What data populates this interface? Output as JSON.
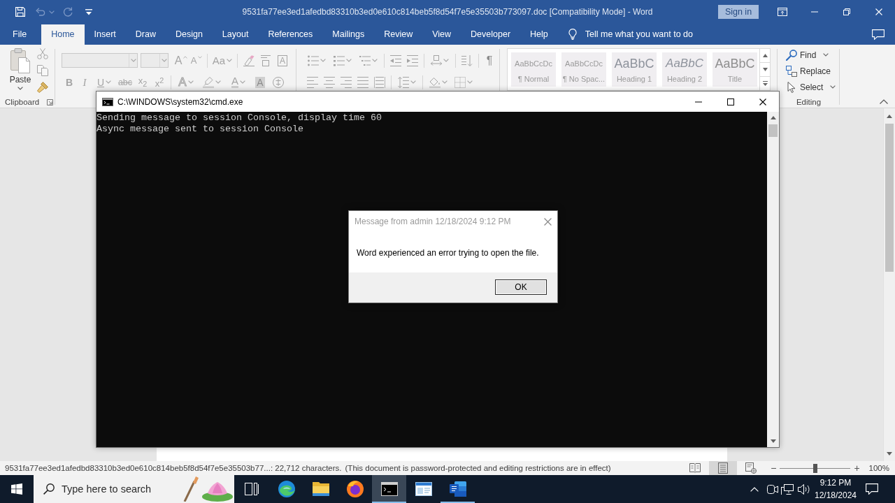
{
  "word_window": {
    "title": "9531fa77ee3ed1afedbd83310b3ed0e610c814beb5f8d54f7e5e35503b773097.doc [Compatibility Mode] - Word",
    "sign_in": "Sign in",
    "tabs": [
      {
        "label": "File",
        "selected": false
      },
      {
        "label": "Home",
        "selected": true
      },
      {
        "label": "Insert",
        "selected": false
      },
      {
        "label": "Draw",
        "selected": false
      },
      {
        "label": "Design",
        "selected": false
      },
      {
        "label": "Layout",
        "selected": false
      },
      {
        "label": "References",
        "selected": false
      },
      {
        "label": "Mailings",
        "selected": false
      },
      {
        "label": "Review",
        "selected": false
      },
      {
        "label": "View",
        "selected": false
      },
      {
        "label": "Developer",
        "selected": false
      },
      {
        "label": "Help",
        "selected": false
      }
    ],
    "tell_me": {
      "placeholder": "Tell me what you want to do"
    },
    "ribbon": {
      "clipboard": {
        "paste": "Paste",
        "label": "Clipboard"
      },
      "font": {
        "row_1": [
          {
            "kind": "grow",
            "label": "A"
          },
          {
            "kind": "shrink",
            "label": "A"
          },
          {
            "kind": "case",
            "label": "Aa"
          },
          {
            "kind": "clear"
          },
          {
            "kind": "phonetic"
          },
          {
            "kind": "border",
            "label": "A"
          }
        ],
        "row_2": [
          {
            "kind": "bold",
            "label": "B"
          },
          {
            "kind": "italic",
            "label": "I"
          },
          {
            "kind": "underline",
            "label": "U"
          },
          {
            "kind": "strike",
            "label": "abc"
          },
          {
            "kind": "subscript",
            "label": "x$_{2}$"
          },
          {
            "kind": "superscript",
            "label": "x$^{2}$"
          },
          {
            "kind": "effects",
            "label": "A"
          },
          {
            "kind": "highlight"
          },
          {
            "kind": "color",
            "label": "A"
          },
          {
            "kind": "shading",
            "label": "A"
          },
          {
            "kind": "enclosed"
          }
        ]
      },
      "paragraph": {
        "show_marks": "¶"
      },
      "styles": [
        {
          "kind": "body",
          "preview": "AaBbCcDc",
          "name": "¶ Normal",
          "selected": false
        },
        {
          "kind": "body",
          "preview": "AaBbCcDc",
          "name": "¶ No Spac...",
          "selected": false
        },
        {
          "kind": "heading",
          "preview": "AaBbC",
          "name": "Heading 1",
          "selected": false
        },
        {
          "kind": "subheading",
          "preview": "AaBbC",
          "name": "Heading 2",
          "selected": false
        },
        {
          "kind": "title",
          "preview": "AaBbC",
          "name": "Title",
          "selected": false
        }
      ],
      "editing": {
        "find": "Find",
        "replace": "Replace",
        "select": "Select",
        "label": "Editing"
      }
    },
    "status_bar": {
      "document_info": "9531fa77ee3ed1afedbd83310b3ed0e610c814beb5f8d54f7e5e35503b77...: 22,712 characters.",
      "restriction": "(This document is password-protected and editing restrictions are in effect)",
      "views": [
        {
          "kind": "read",
          "selected": false
        },
        {
          "kind": "print",
          "selected": true
        },
        {
          "kind": "web",
          "selected": false
        }
      ],
      "zoom": {
        "minus": "−",
        "plus": "+",
        "level": 0.5,
        "reading": "100%"
      }
    }
  },
  "cmd_window": {
    "title": "C:\\WINDOWS\\system32\\cmd.exe",
    "lines": [
      "Sending message to session Console, display time 60",
      "Async message sent to session Console"
    ]
  },
  "message_dialog": {
    "title": "Message from admin 12/18/2024 9:12 PM",
    "message": "Word experienced an error trying to open the file.",
    "buttons": [
      "OK"
    ]
  },
  "taskbar": {
    "search": {
      "placeholder": "Type here to search"
    },
    "apps": [
      {
        "kind": "swirl",
        "selected": false,
        "running": false
      },
      {
        "kind": "folder",
        "selected": false,
        "running": false
      },
      {
        "kind": "globe",
        "selected": false,
        "running": false
      },
      {
        "kind": "terminal",
        "selected": true,
        "running": true
      },
      {
        "kind": "window",
        "selected": false,
        "running": false
      },
      {
        "kind": "document",
        "selected": false,
        "running": true
      }
    ],
    "clock": {
      "time": "9:12 PM",
      "date": "12/18/2024"
    }
  }
}
